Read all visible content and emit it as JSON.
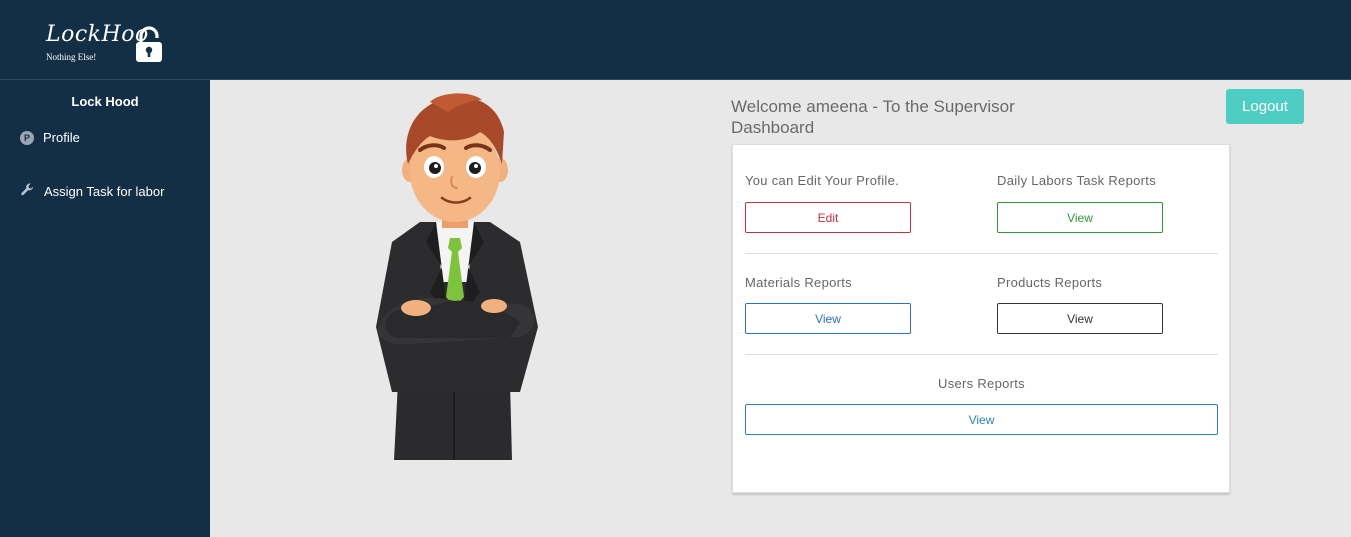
{
  "brand": {
    "name": "LockHoo",
    "tagline": "Nothing Else!"
  },
  "sidebar": {
    "title": "Lock Hood",
    "items": [
      {
        "label": "Profile",
        "icon": "profile-p-icon"
      },
      {
        "label": "Assign Task for labor",
        "icon": "wrench-icon"
      }
    ]
  },
  "header": {
    "welcome": "Welcome ameena - To the Supervisor Dashboard",
    "logout_label": "Logout"
  },
  "dashboard": {
    "profile": {
      "label": "You can Edit Your Profile.",
      "button": "Edit"
    },
    "daily_labors": {
      "label": "Daily Labors Task Reports",
      "button": "View"
    },
    "materials": {
      "label": "Materials Reports",
      "button": "View"
    },
    "products": {
      "label": "Products Reports",
      "button": "View"
    },
    "users": {
      "label": "Users Reports",
      "button": "View"
    }
  },
  "colors": {
    "nav_bg": "#132f46",
    "accent_teal": "#4ecdc4",
    "edit_red": "#c9303e",
    "view_green": "#2f9a3a",
    "view_blue": "#2f6fc4",
    "view_dark": "#333333",
    "view_teal": "#2a88b0"
  }
}
